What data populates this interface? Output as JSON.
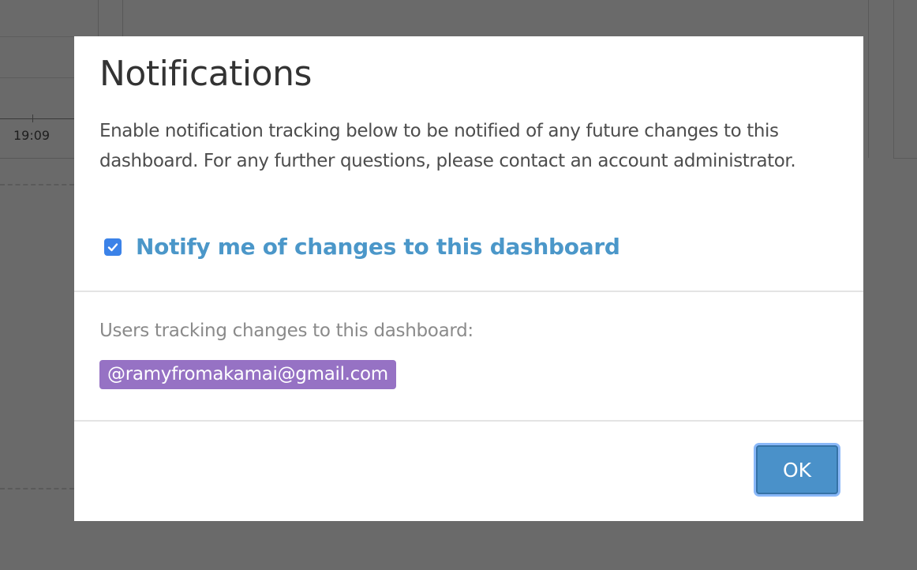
{
  "background": {
    "axis_time_label": "19:09"
  },
  "modal": {
    "title": "Notifications",
    "description": "Enable notification tracking below to be notified of any future changes to this dashboard. For any further questions, please contact an account administrator.",
    "notify_checkbox": {
      "label": "Notify me of changes to this dashboard",
      "checked": true
    },
    "users_label": "Users tracking changes to this dashboard:",
    "tracking_users": [
      "@ramyfromakamai@gmail.com"
    ],
    "ok_label": "OK"
  },
  "colors": {
    "overlay": "#6a6a6a",
    "accent_text": "#4b97c9",
    "checkbox": "#3b82e8",
    "user_tag": "#9672c4",
    "ok_button": "#4a91c9"
  }
}
